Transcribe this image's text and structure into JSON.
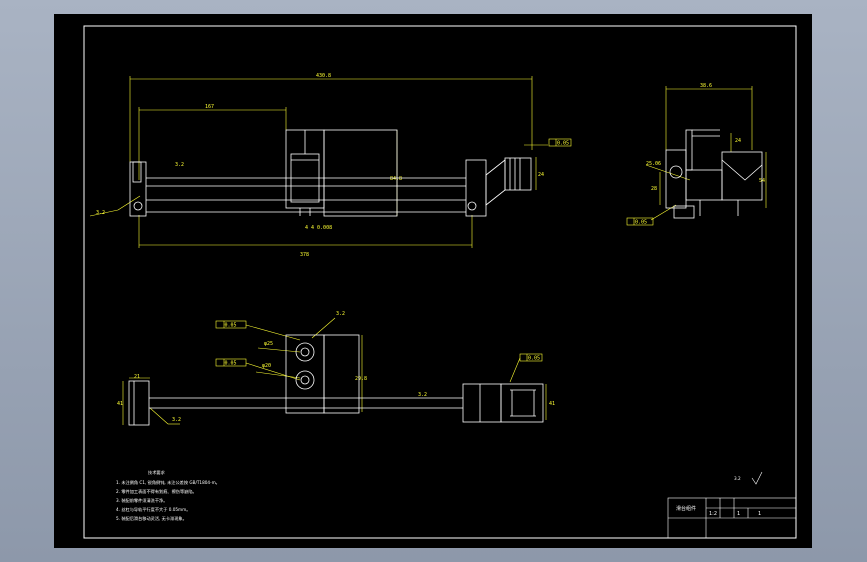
{
  "drawing": {
    "top_view": {
      "overall_length": "430.8",
      "left_block": "167",
      "base_length": "378",
      "height_right": "24",
      "height_mid": "84.8",
      "tolerance_tag": "0.05",
      "roughness": "3.2",
      "roughness_left": "3.2",
      "note_small": "4 4 0.008"
    },
    "side_view": {
      "top_width": "38.6",
      "right_height": "54",
      "left_height": "28",
      "angle": "25.06",
      "tolerance_tag": "0.05",
      "top_small": "24"
    },
    "bottom_view": {
      "tol_1": "0.05",
      "tol_2": "0.05",
      "tol_3": "0.05",
      "width_label": "21",
      "height_label": "41",
      "height_mid": "29.8",
      "height_right": "41",
      "roughness_1": "3.2",
      "roughness_2": "3.2",
      "roughness_3": "3.2",
      "dia_1": "φ25",
      "dia_2": "φ20"
    },
    "notes": {
      "title": "技术要求",
      "lines": [
        "1. 未注倒角 C1, 锐角倒钝, 未注公差按 GB/T1804-m。",
        "2. 零件加工表面不得有划痕、擦伤等缺陷。",
        "3. 装配前零件须清洗干净。",
        "4. 丝杠与导轨平行度不大于 0.05mm。",
        "5. 装配后滑台移动灵活, 无卡滞现象。"
      ]
    },
    "roughness_general": "3.2",
    "title_block": {
      "name": "滑台组件",
      "scale": "1:2",
      "sheet": "1",
      "count": "1"
    }
  }
}
